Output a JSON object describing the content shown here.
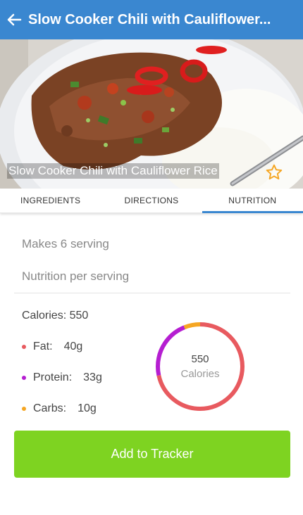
{
  "header": {
    "title": "Slow Cooker Chili with Cauliflower...",
    "back_icon": "arrow-left-icon"
  },
  "hero": {
    "caption": "Slow Cooker Chili with Cauliflower Rice",
    "favorite_icon": "star-outline-icon"
  },
  "tabs": [
    {
      "label": "INGREDIENTS",
      "active": false
    },
    {
      "label": "DIRECTIONS",
      "active": false
    },
    {
      "label": "NUTRITION",
      "active": true
    }
  ],
  "nutrition": {
    "makes": "Makes 6 serving",
    "per_serving": "Nutrition per serving",
    "calories_line": "Calories: 550",
    "macros": [
      {
        "label": "Fat:",
        "value": "40g",
        "color": "#e85a5f"
      },
      {
        "label": "Protein:",
        "value": "33g",
        "color": "#b51ed1"
      },
      {
        "label": "Carbs:",
        "value": "10g",
        "color": "#f5a623"
      }
    ],
    "ring": {
      "value": "550",
      "label": "Calories"
    }
  },
  "actions": {
    "add_label": "Add to Tracker",
    "color": "#7ed321"
  },
  "colors": {
    "primary": "#3a87d0"
  }
}
